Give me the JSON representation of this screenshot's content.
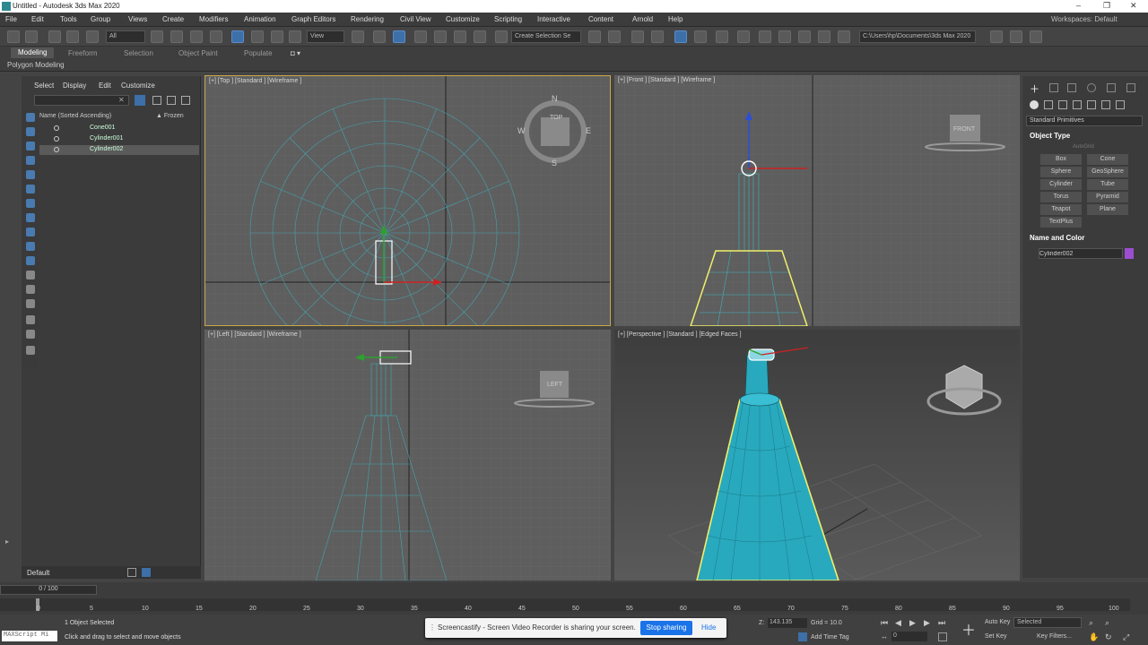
{
  "title": "Untitled - Autodesk 3ds Max 2020",
  "workspaces": "Workspaces: Default",
  "menus": [
    "File",
    "Edit",
    "Tools",
    "Group",
    "Views",
    "Create",
    "Modifiers",
    "Animation",
    "Graph Editors",
    "Rendering",
    "Civil View",
    "Customize",
    "Scripting",
    "Interactive",
    "Content",
    "Arnold",
    "Help"
  ],
  "toolbar": {
    "filter_dropdown": "All",
    "view_dropdown": "View",
    "selection_set": "Create Selection Se",
    "project_path": "C:\\Users\\hp\\Documents\\3ds Max 2020"
  },
  "ribbon": {
    "tabs": [
      "Modeling",
      "Freeform",
      "Selection",
      "Object Paint",
      "Populate"
    ],
    "panel_label": "Polygon Modeling"
  },
  "scene_explorer": {
    "tabs": [
      "Select",
      "Display",
      "Edit",
      "Customize"
    ],
    "column_name": "Name (Sorted Ascending)",
    "column_frozen": "▲ Frozen",
    "objects": [
      "Cone001",
      "Cylinder001",
      "Cylinder002"
    ],
    "layer": "Default"
  },
  "viewports": {
    "top": "[+] [Top ] [Standard ] [Wireframe ]",
    "front": "[+] [Front ] [Standard ] [Wireframe ]",
    "left": "[+] [Left ] [Standard ] [Wireframe ]",
    "perspective": "[+] [Perspective ] [Standard ] [Edged Faces ]",
    "viewcube_top": "TOP",
    "viewcube_front": "FRONT",
    "viewcube_left": "LEFT",
    "compass": {
      "n": "N",
      "s": "S",
      "e": "E",
      "w": "W"
    }
  },
  "command_panel": {
    "category": "Standard Primitives",
    "object_type_title": "Object Type",
    "autogrid": "AutoGrid",
    "buttons": [
      "Box",
      "Cone",
      "Sphere",
      "GeoSphere",
      "Cylinder",
      "Tube",
      "Torus",
      "Pyramid",
      "Teapot",
      "Plane",
      "TextPlus"
    ],
    "name_color_title": "Name and Color",
    "object_name": "Cylinder002",
    "object_color": "#9b4fd0"
  },
  "timeline": {
    "frame": "0 / 100",
    "ticks": [
      "0",
      "5",
      "10",
      "15",
      "20",
      "25",
      "30",
      "35",
      "40",
      "45",
      "50",
      "55",
      "60",
      "65",
      "70",
      "75",
      "80",
      "85",
      "90",
      "95",
      "100"
    ]
  },
  "status": {
    "script_label": "MAXScript Mi",
    "selection": "1 Object Selected",
    "prompt": "Click and drag to select and move objects",
    "z_label": "Z:",
    "z_value": "143.135",
    "grid": "Grid = 10.0",
    "add_time_tag": "Add Time Tag",
    "auto_key": "Auto Key",
    "set_key": "Set Key",
    "selected": "Selected",
    "key_filters": "Key Filters...",
    "frame_field": "0"
  },
  "share_bar": {
    "message": "Screencastify - Screen Video Recorder is sharing your screen.",
    "stop": "Stop sharing",
    "hide": "Hide"
  },
  "colors": {
    "accent": "#3d6fa8",
    "selection_highlight": "#f0f06a",
    "object_cyan": "#29a9bd"
  }
}
